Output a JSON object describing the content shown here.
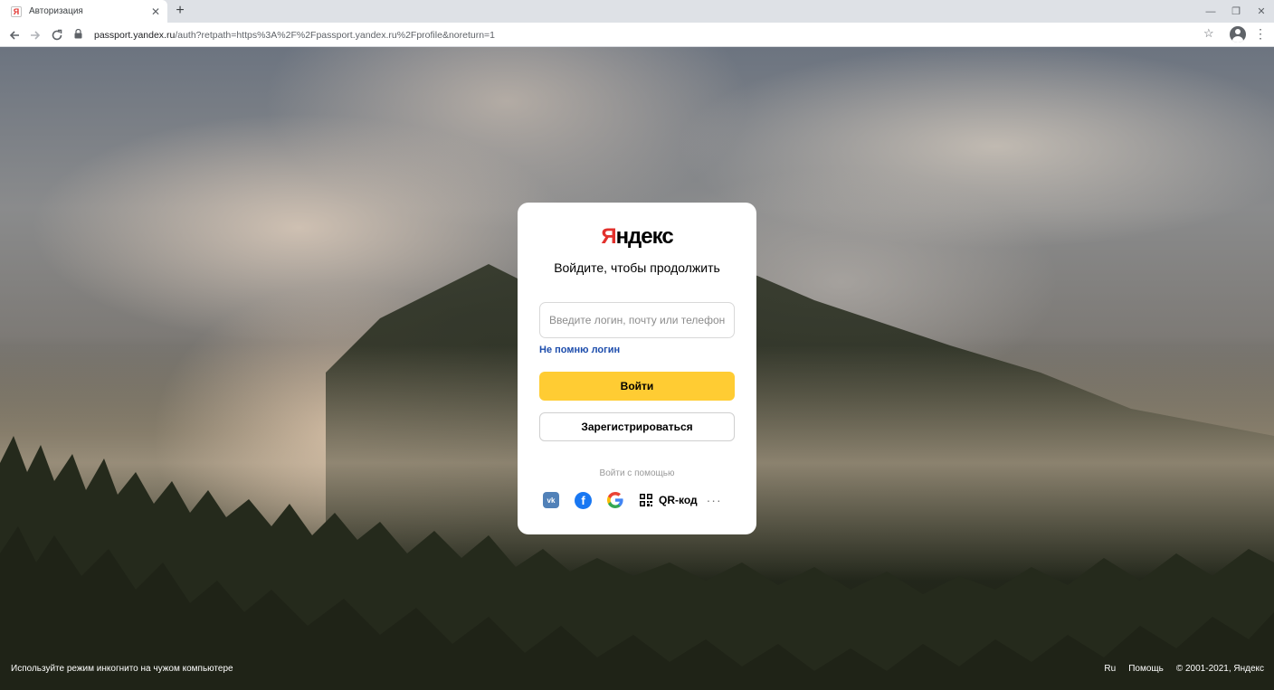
{
  "browser": {
    "tab_title": "Авторизация",
    "tab_favicon": "Я",
    "tab_close": "✕",
    "new_tab": "+",
    "window_controls": {
      "minimize": "—",
      "restore": "❐",
      "close": "✕"
    },
    "url_host": "passport.yandex.ru",
    "url_rest": "/auth?retpath=https%3A%2F%2Fpassport.yandex.ru%2Fprofile&noreturn=1",
    "icons": [
      "back-icon",
      "forward-icon",
      "reload-icon",
      "lock-icon",
      "star-icon",
      "profile-icon",
      "menu-icon"
    ]
  },
  "card": {
    "logo_first": "Я",
    "logo_rest": "ндекс",
    "headline": "Войдите, чтобы продолжить",
    "login_placeholder": "Введите логин, почту или телефон",
    "login_value": "",
    "forgot_link": "Не помню логин",
    "login_button": "Войти",
    "register_button": "Зарегистрироваться",
    "social_label": "Войти с помощью",
    "social": {
      "vk": "vk",
      "facebook": "f",
      "qr_label": "QR-код",
      "more": "···"
    }
  },
  "footer": {
    "left": "Используйте режим инкогнито на чужом компьютере",
    "lang": "Ru",
    "help": "Помощь",
    "copyright": "© 2001-2021, Яндекс"
  },
  "colors": {
    "accent_yellow": "#ffcc33",
    "link_blue": "#1d4dac",
    "logo_red": "#e2312d"
  }
}
